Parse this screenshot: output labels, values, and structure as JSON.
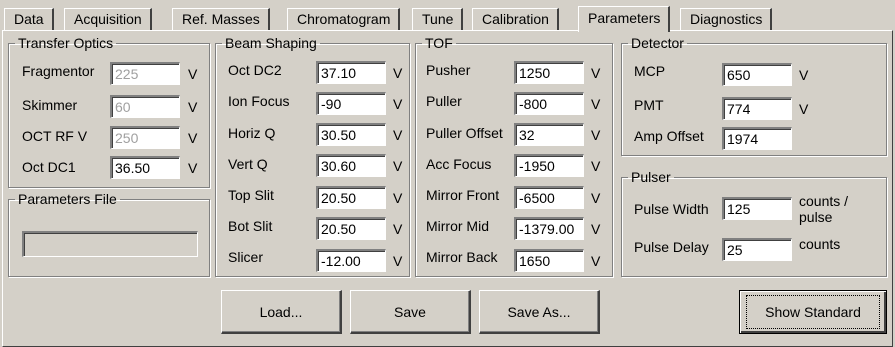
{
  "tabs": [
    "Data",
    "Acquisition",
    "Ref. Masses",
    "Chromatogram",
    "Tune",
    "Calibration",
    "Parameters",
    "Diagnostics"
  ],
  "active_tab": "Parameters",
  "transfer_optics": {
    "title": "Transfer Optics",
    "rows": [
      {
        "label": "Fragmentor",
        "value": "225",
        "unit": "V"
      },
      {
        "label": "Skimmer",
        "value": "60",
        "unit": "V"
      },
      {
        "label": "OCT RF V",
        "value": "250",
        "unit": "V"
      },
      {
        "label": "Oct DC1",
        "value": "36.50",
        "unit": "V"
      }
    ]
  },
  "parameters_file": {
    "title": "Parameters File",
    "value": ""
  },
  "beam_shaping": {
    "title": "Beam Shaping",
    "rows": [
      {
        "label": "Oct DC2",
        "value": "37.10",
        "unit": "V"
      },
      {
        "label": "Ion Focus",
        "value": "-90",
        "unit": "V"
      },
      {
        "label": "Horiz Q",
        "value": "30.50",
        "unit": "V"
      },
      {
        "label": "Vert Q",
        "value": "30.60",
        "unit": "V"
      },
      {
        "label": "Top Slit",
        "value": "20.50",
        "unit": "V"
      },
      {
        "label": "Bot Slit",
        "value": "20.50",
        "unit": "V"
      },
      {
        "label": "Slicer",
        "value": "-12.00",
        "unit": "V"
      }
    ]
  },
  "tof": {
    "title": "TOF",
    "rows": [
      {
        "label": "Pusher",
        "value": "1250",
        "unit": "V"
      },
      {
        "label": "Puller",
        "value": "-800",
        "unit": "V"
      },
      {
        "label": "Puller Offset",
        "value": "32",
        "unit": "V"
      },
      {
        "label": "Acc Focus",
        "value": "-1950",
        "unit": "V"
      },
      {
        "label": "Mirror Front",
        "value": "-6500",
        "unit": "V"
      },
      {
        "label": "Mirror Mid",
        "value": "-1379.00",
        "unit": "V"
      },
      {
        "label": "Mirror Back",
        "value": "1650",
        "unit": "V"
      }
    ]
  },
  "detector": {
    "title": "Detector",
    "rows": [
      {
        "label": "MCP",
        "value": "650",
        "unit": "V"
      },
      {
        "label": "PMT",
        "value": "774",
        "unit": "V"
      },
      {
        "label": "Amp Offset",
        "value": "1974",
        "unit": ""
      }
    ]
  },
  "pulser": {
    "title": "Pulser",
    "rows": [
      {
        "label": "Pulse Width",
        "value": "125",
        "unit_line1": "counts /",
        "unit_line2": "pulse"
      },
      {
        "label": "Pulse Delay",
        "value": "25",
        "unit_line1": "counts",
        "unit_line2": ""
      }
    ]
  },
  "buttons": {
    "load": "Load...",
    "save": "Save",
    "save_as": "Save As...",
    "show_standard": "Show Standard"
  }
}
